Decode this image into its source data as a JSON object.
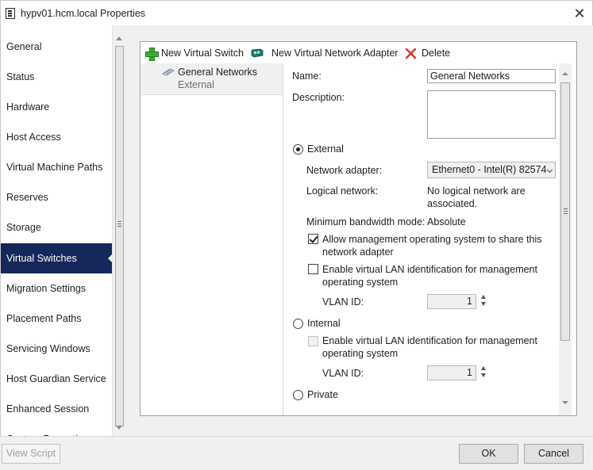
{
  "window": {
    "title": "hypv01.hcm.local Properties",
    "close_glyph": "✕",
    "icon": "properties-window-icon"
  },
  "sidebar": {
    "items": [
      {
        "label": "General"
      },
      {
        "label": "Status"
      },
      {
        "label": "Hardware"
      },
      {
        "label": "Host Access"
      },
      {
        "label": "Virtual Machine Paths"
      },
      {
        "label": "Reserves"
      },
      {
        "label": "Storage"
      },
      {
        "label": "Virtual Switches",
        "selected": true
      },
      {
        "label": "Migration Settings"
      },
      {
        "label": "Placement Paths"
      },
      {
        "label": "Servicing Windows"
      },
      {
        "label": "Host Guardian Service"
      },
      {
        "label": "Enhanced Session"
      },
      {
        "label": "Custom Properties"
      }
    ],
    "selected_color": "#16285a"
  },
  "toolbar": {
    "new_switch_label": "New Virtual Switch",
    "new_adapter_label": "New Virtual Network Adapter",
    "delete_label": "Delete"
  },
  "switch_list": {
    "items": [
      {
        "name": "General Networks",
        "type": "External"
      }
    ]
  },
  "details": {
    "name_label": "Name:",
    "name_value": "General Networks",
    "description_label": "Description:",
    "description_value": "",
    "external_label": "External",
    "external_selected": true,
    "network_adapter_label": "Network adapter:",
    "network_adapter_value": "Ethernet0 - Intel(R) 82574",
    "logical_network_label": "Logical network:",
    "logical_network_line1": "No logical network are",
    "logical_network_line2": "associated.",
    "min_bandwidth_label": "Minimum bandwidth mode:",
    "min_bandwidth_value": "Absolute",
    "allow_mgmt_line1": "Allow management operating system to share this",
    "allow_mgmt_line2": "network adapter",
    "allow_mgmt_checked": true,
    "enable_vlan_line1": "Enable virtual LAN identification for management",
    "enable_vlan_line2": "operating system",
    "enable_vlan_checked": false,
    "vlan_id_label": "VLAN ID:",
    "vlan_id_value": "1",
    "internal_label": "Internal",
    "internal_enable_vlan_line1": "Enable virtual LAN identification for management",
    "internal_enable_vlan_line2": "operating system",
    "internal_vlan_id_label": "VLAN ID:",
    "internal_vlan_id_value": "1",
    "private_label": "Private"
  },
  "footer": {
    "view_script_label": "View Script",
    "ok_label": "OK",
    "cancel_label": "Cancel"
  }
}
